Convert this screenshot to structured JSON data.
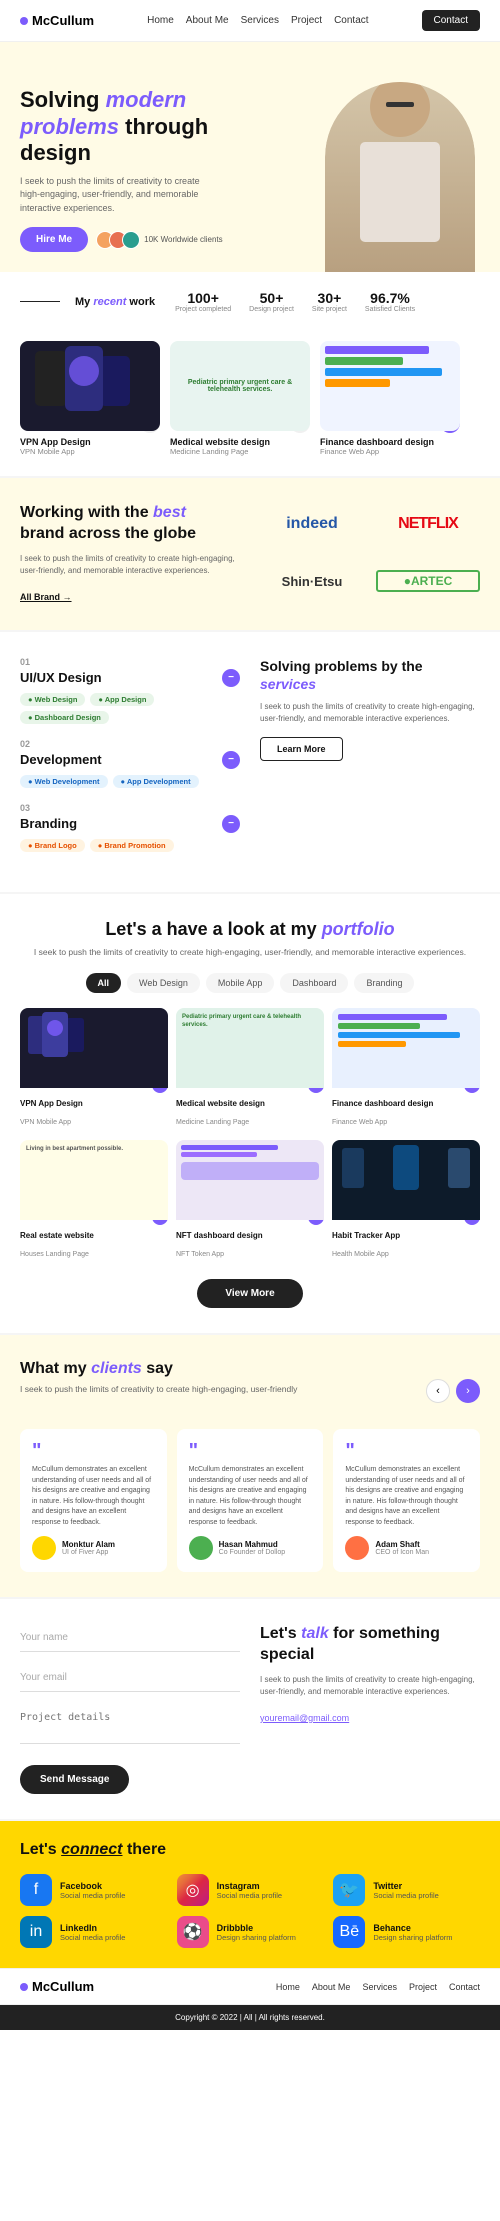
{
  "nav": {
    "logo": "McCullum",
    "links": [
      "Home",
      "About Me",
      "Services",
      "Project",
      "Contact"
    ],
    "contact_btn": "Contact"
  },
  "hero": {
    "title_line1": "Solving ",
    "title_italic": "modern",
    "title_line2": "problems",
    "title_line3": " through",
    "title_line4": "design",
    "description": "I seek to push the limits of creativity to create high-engaging, user-friendly, and memorable interactive experiences.",
    "hire_btn": "Hire Me",
    "clients_count": "10K Worldwide clients"
  },
  "stats": {
    "label": "My recent work",
    "label_italic": "recent",
    "items": [
      {
        "number": "100+",
        "desc": "Project completed"
      },
      {
        "number": "50+",
        "desc": "Design project"
      },
      {
        "number": "30+",
        "desc": "Site project"
      },
      {
        "number": "96.7%",
        "desc": "Satisfied Clients"
      }
    ]
  },
  "work_cards": [
    {
      "title": "VPN App Design",
      "subtitle": "VPN Mobile App",
      "arrow_style": "normal"
    },
    {
      "title": "Medical website design",
      "subtitle": "Medicine Landing Page",
      "arrow_style": "normal"
    },
    {
      "title": "Finance dashboard design",
      "subtitle": "Finance Web App",
      "arrow_style": "purple"
    }
  ],
  "brands": {
    "heading_pre": "Working with the ",
    "heading_italic": "best",
    "heading_post": " brand across the globe",
    "description": "I seek to push the limits of creativity to create high-engaging, user-friendly, and memorable interactive experiences.",
    "all_brand_link": "All Brand →",
    "logos": [
      "indeed",
      "NETFLIX",
      "Shin·Etsu",
      "ARTEC"
    ]
  },
  "services": {
    "heading_pre": "Solving problems by the ",
    "heading_italic": "services",
    "description": "I seek to push the limits of creativity to create high-engaging, user-friendly, and memorable interactive experiences.",
    "learn_btn": "Learn More",
    "items": [
      {
        "num": "01",
        "title": "UI/UX Design",
        "tags": [
          {
            "label": "Web Design",
            "color": "green"
          },
          {
            "label": "App Design",
            "color": "green"
          },
          {
            "label": "Dashboard Design",
            "color": "green"
          }
        ]
      },
      {
        "num": "02",
        "title": "Development",
        "tags": [
          {
            "label": "Web Development",
            "color": "blue"
          },
          {
            "label": "App Development",
            "color": "blue"
          }
        ]
      },
      {
        "num": "03",
        "title": "Branding",
        "tags": [
          {
            "label": "Brand Logo",
            "color": "orange"
          },
          {
            "label": "Brand Promotion",
            "color": "orange"
          }
        ]
      }
    ]
  },
  "portfolio": {
    "heading_pre": "Let's a have a look at my ",
    "heading_italic": "portfolio",
    "description": "I seek to push the limits of creativity to create high-engaging, user-friendly, and memorable interactive experiences.",
    "tabs": [
      "All",
      "Web Design",
      "Mobile App",
      "Dashboard",
      "Branding"
    ],
    "active_tab": "All",
    "view_more_btn": "View More",
    "cards": [
      {
        "title": "VPN App Design",
        "subtitle": "VPN Mobile App",
        "bg": "dark"
      },
      {
        "title": "Medical website design",
        "subtitle": "Medicine Landing Page",
        "bg": "green"
      },
      {
        "title": "Finance dashboard design",
        "subtitle": "Finance Web App",
        "bg": "blue"
      },
      {
        "title": "Real estate website",
        "subtitle": "Houses Landing Page",
        "bg": "yellow"
      },
      {
        "title": "NFT dashboard design",
        "subtitle": "NFT Token App",
        "bg": "purple"
      },
      {
        "title": "Habit Tracker App",
        "subtitle": "Health Mobile App",
        "bg": "darkblue"
      }
    ]
  },
  "testimonials": {
    "heading_pre": "What my ",
    "heading_italic": "clients",
    "heading_post": " say",
    "description": "I seek to push the limits of creativity to create high-engaging, user-friendly",
    "cards": [
      {
        "quote": "\"",
        "text": "McCullum demonstrates an excellent understanding of user needs and all of his designs are creative and engaging in nature. His follow-through thought and designs have an excellent response to feedback.",
        "author": "Monktur Alam",
        "role": "UI of Fiver App",
        "avatar_color": "yellow"
      },
      {
        "quote": "\"",
        "text": "McCullum demonstrates an excellent understanding of user needs and all of his designs are creative and engaging in nature. His follow-through thought and designs have an excellent response to feedback.",
        "author": "Hasan Mahmud",
        "role": "Co Founder of Dollop",
        "avatar_color": "green"
      },
      {
        "quote": "\"",
        "text": "McCullum demonstrates an excellent understanding of user needs and all of his designs are creative and engaging in nature. His follow-through thought and designs have an excellent response to feedback.",
        "author": "Adam Shaft",
        "role": "CEO of Icon Man",
        "avatar_color": "orange"
      }
    ]
  },
  "contact": {
    "heading_pre": "Let's ",
    "heading_italic": "talk",
    "heading_post": " for something special",
    "description": "I seek to push the limits of creativity to create high-engaging, user-friendly, and memorable interactive experiences.",
    "email": "youremail@gmail.com",
    "form": {
      "name_placeholder": "Your name",
      "email_placeholder": "Your email",
      "project_placeholder": "Project details",
      "send_btn": "Send Message"
    }
  },
  "social": {
    "heading_pre": "Let's ",
    "heading_italic": "connect",
    "heading_post": " there",
    "items": [
      {
        "name": "Facebook",
        "handle": "Social media profile",
        "icon_type": "facebook"
      },
      {
        "name": "Instagram",
        "handle": "Social media profile",
        "icon_type": "instagram"
      },
      {
        "name": "Twitter",
        "handle": "Social media profile",
        "icon_type": "twitter"
      },
      {
        "name": "LinkedIn",
        "handle": "Social media profile",
        "icon_type": "linkedin"
      },
      {
        "name": "Dribbble",
        "handle": "Design sharing platform",
        "icon_type": "dribbble"
      },
      {
        "name": "Behance",
        "handle": "Design sharing platform",
        "icon_type": "behance"
      }
    ]
  },
  "footer_nav": {
    "logo": "McCullum",
    "links": [
      "Home",
      "About Me",
      "Services",
      "Project",
      "Contact"
    ],
    "copyright": "Copyright © 2022 | All | All rights reserved."
  }
}
